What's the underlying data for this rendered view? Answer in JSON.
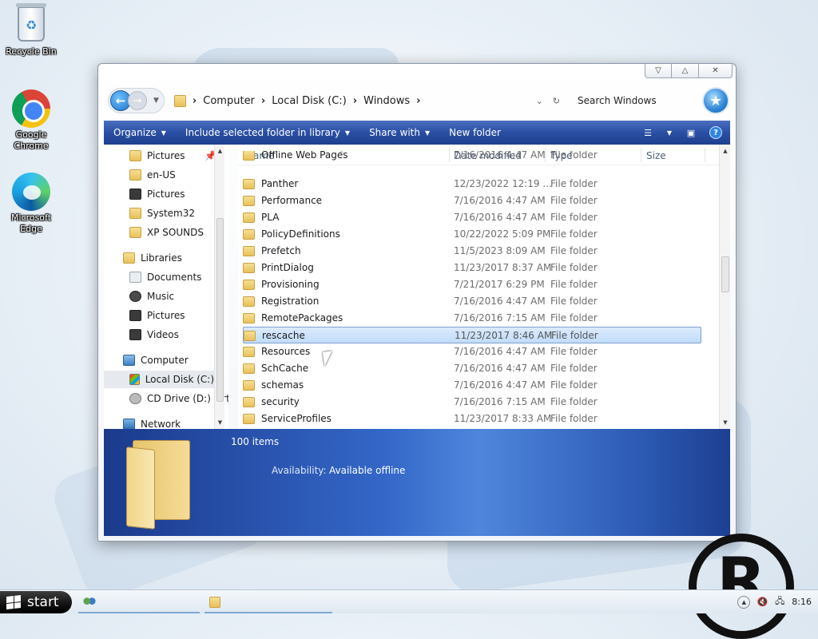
{
  "desktop": {
    "icons": [
      {
        "label": "Recycle Bin",
        "icon": "recycle-bin-icon"
      },
      {
        "label": "Google Chrome",
        "icon": "chrome-icon"
      },
      {
        "label": "Microsoft Edge",
        "icon": "edge-icon"
      }
    ]
  },
  "window": {
    "caption_buttons": {
      "minimize": "▽",
      "maximize": "△",
      "close": "✕"
    },
    "breadcrumbs": [
      "Computer",
      "Local Disk (C:)",
      "Windows"
    ],
    "breadcrumb_separator": "›",
    "search_placeholder": "Search Windows",
    "toolbar": {
      "organize": "Organize",
      "include_library": "Include selected folder in library",
      "share_with": "Share with",
      "new_folder": "New folder"
    },
    "nav_pane": {
      "items": [
        {
          "label": "Pictures",
          "icon": "folder-icon"
        },
        {
          "label": "en-US",
          "icon": "folder-icon"
        },
        {
          "label": "Pictures",
          "icon": "pictures-icon"
        },
        {
          "label": "System32",
          "icon": "folder-icon"
        },
        {
          "label": "XP SOUNDS",
          "icon": "folder-icon"
        },
        {
          "label": "Libraries",
          "icon": "folder-icon"
        },
        {
          "label": "Documents",
          "icon": "documents-icon"
        },
        {
          "label": "Music",
          "icon": "music-icon"
        },
        {
          "label": "Pictures",
          "icon": "pictures-icon"
        },
        {
          "label": "Videos",
          "icon": "videos-icon"
        },
        {
          "label": "Computer",
          "icon": "computer-icon"
        },
        {
          "label": "Local Disk (C:)",
          "icon": "local-disk-icon"
        },
        {
          "label": "CD Drive (D:) virt",
          "icon": "cd-drive-icon"
        },
        {
          "label": "Network",
          "icon": "network-icon"
        }
      ],
      "selected": "Local Disk (C:)"
    },
    "columns": {
      "name": "Name",
      "date_modified": "Date modified",
      "type": "Type",
      "size": "Size"
    },
    "files": [
      {
        "name": "Offline Web Pages",
        "date": "7/16/2016 4:47 AM",
        "type": "File folder"
      },
      {
        "name": "Panther",
        "date": "12/23/2022 12:19 ...",
        "type": "File folder"
      },
      {
        "name": "Performance",
        "date": "7/16/2016 4:47 AM",
        "type": "File folder"
      },
      {
        "name": "PLA",
        "date": "7/16/2016 4:47 AM",
        "type": "File folder"
      },
      {
        "name": "PolicyDefinitions",
        "date": "10/22/2022 5:09 PM",
        "type": "File folder"
      },
      {
        "name": "Prefetch",
        "date": "11/5/2023 8:09 AM",
        "type": "File folder"
      },
      {
        "name": "PrintDialog",
        "date": "11/23/2017 8:37 AM",
        "type": "File folder"
      },
      {
        "name": "Provisioning",
        "date": "7/21/2017 6:29 PM",
        "type": "File folder"
      },
      {
        "name": "Registration",
        "date": "7/16/2016 4:47 AM",
        "type": "File folder"
      },
      {
        "name": "RemotePackages",
        "date": "7/16/2016 7:15 AM",
        "type": "File folder"
      },
      {
        "name": "rescache",
        "date": "11/23/2017 8:46 AM",
        "type": "File folder"
      },
      {
        "name": "Resources",
        "date": "7/16/2016 4:47 AM",
        "type": "File folder"
      },
      {
        "name": "SchCache",
        "date": "7/16/2016 4:47 AM",
        "type": "File folder"
      },
      {
        "name": "schemas",
        "date": "7/16/2016 4:47 AM",
        "type": "File folder"
      },
      {
        "name": "security",
        "date": "7/16/2016 7:15 AM",
        "type": "File folder"
      },
      {
        "name": "ServiceProfiles",
        "date": "11/23/2017 8:33 AM",
        "type": "File folder"
      }
    ],
    "selected_file": "rescache",
    "details": {
      "item_count": "100 items",
      "availability_label": "Availability:",
      "availability_value": "Available offline"
    }
  },
  "watermark": "R",
  "taskbar": {
    "start_label": "start",
    "clock": "8:16"
  }
}
